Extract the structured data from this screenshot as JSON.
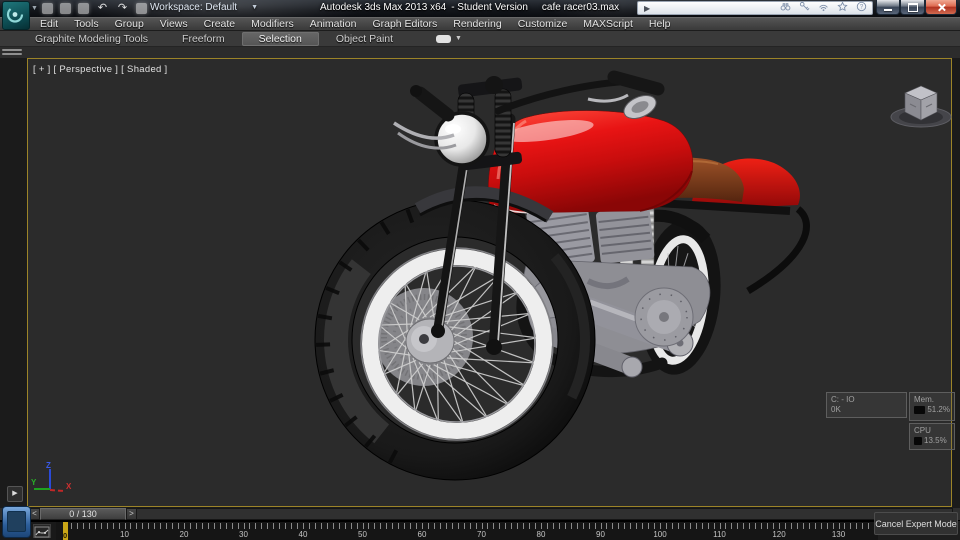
{
  "colors": {
    "accent_red": "#e01313",
    "seat_brown": "#8a4a26",
    "engine_silver": "#96969c",
    "rim_white": "#eeeeee",
    "viewport_bg": "#2b2b2b",
    "active_viewport_border": "#9c8428",
    "timeline_marker_yellow": "#c9a617",
    "app_icon_teal": "#0d5c60"
  },
  "titlebar": {
    "workspace": "Workspace: Default",
    "title": "Autodesk 3ds Max 2013 x64",
    "edition": "- Student Version",
    "filename": "cafe racer03.max",
    "quick_access_icons": [
      "new-scene",
      "open-file",
      "save-file",
      "undo",
      "redo",
      "project-folder"
    ],
    "infocenter_icons": [
      "search-binoculars",
      "sign-in-key",
      "communication-center",
      "favorites-star",
      "help"
    ],
    "window_controls": [
      "minimize",
      "maximize",
      "close"
    ]
  },
  "menu_bar": {
    "items": [
      "Edit",
      "Tools",
      "Group",
      "Views",
      "Create",
      "Modifiers",
      "Animation",
      "Graph Editors",
      "Rendering",
      "Customize",
      "MAXScript",
      "Help"
    ]
  },
  "ribbon": {
    "tabs": [
      {
        "label": "Graphite Modeling Tools",
        "active": false
      },
      {
        "label": "Freeform",
        "active": false
      },
      {
        "label": "Selection",
        "active": true
      },
      {
        "label": "Object Paint",
        "active": false
      }
    ]
  },
  "viewport": {
    "label": "[ + ] [ Perspective ] [ Shaded ]",
    "scene_object": "red cafe racer motorcycle model",
    "axis_tripod": {
      "x": "X",
      "y": "Y",
      "z": "Z"
    },
    "stats": {
      "io_label": "C: - IO",
      "io_value": "0K",
      "mem_label": "Mem.",
      "mem_value": "51.2%",
      "cpu_label": "CPU",
      "cpu_value": "13.5%"
    }
  },
  "timeline": {
    "slider_value": "0 / 130",
    "current_frame": 0,
    "start": 0,
    "end": 130,
    "label_step": 10,
    "prev_button": "<",
    "next_button": ">"
  },
  "statusbar": {
    "cancel_expert_button": "Cancel Expert Mode"
  }
}
